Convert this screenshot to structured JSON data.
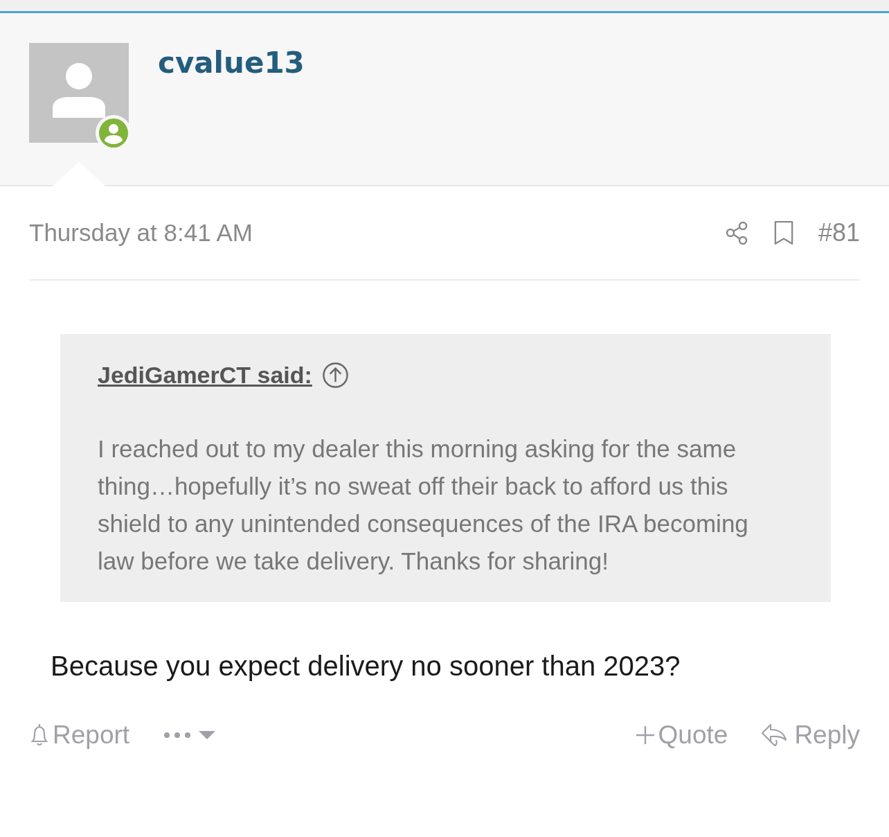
{
  "post": {
    "username": "cvalue13",
    "online": true,
    "time": "Thursday at 8:41 AM",
    "number": "#81",
    "quote": {
      "author": "JediGamerCT said:",
      "text": "I reached out to my dealer this morning asking for the same thing…hopefully it’s no sweat off their back to afford us this shield to any unintended consequences of the IRA becoming law before we take delivery. Thanks for sharing!"
    },
    "body": "Because you expect delivery no sooner than 2023?",
    "actions_left": [
      {
        "kind": "report",
        "label": "Report"
      },
      {
        "kind": "more"
      }
    ],
    "actions_right": [
      {
        "kind": "quote",
        "label": "Quote"
      },
      {
        "kind": "reply",
        "label": "Reply"
      }
    ]
  }
}
